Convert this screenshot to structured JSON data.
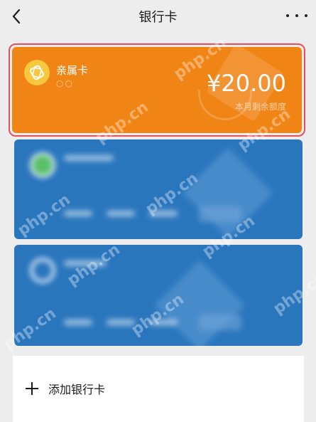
{
  "header": {
    "title": "银行卡",
    "back_icon": "chevron-left-icon",
    "more_icon": "more-dots-icon"
  },
  "family_card": {
    "name": "亲属卡",
    "masked": "○○",
    "amount": "¥20.00",
    "caption": "本月剩余额度",
    "color": "#f08516",
    "highlight_color": "#e8505b"
  },
  "bank_cards": [
    {
      "color": "#2a76bd",
      "blurred": true
    },
    {
      "color": "#2a76bd",
      "blurred": true
    }
  ],
  "add_card": {
    "label": "添加银行卡",
    "icon": "plus-icon"
  },
  "watermark": "php.cn"
}
